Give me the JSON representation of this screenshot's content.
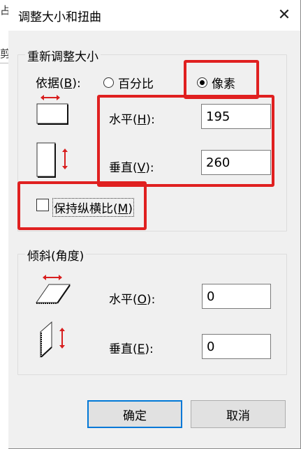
{
  "behind": {
    "glyph_top": "占",
    "glyph_mid": "剪"
  },
  "dialog": {
    "title": "调整大小和扭曲",
    "close_glyph": "✕"
  },
  "resize": {
    "legend": "重新调整大小",
    "basis_label_pre": "依据(",
    "basis_label_key": "B",
    "basis_label_post": "):",
    "options": [
      {
        "label": "百分比",
        "selected": false
      },
      {
        "label": "像素",
        "selected": true
      }
    ],
    "horizontal": {
      "label_pre": "水平(",
      "label_key": "H",
      "label_post": "):",
      "value": "195"
    },
    "vertical": {
      "label_pre": "垂直(",
      "label_key": "V",
      "label_post": "):",
      "value": "260"
    },
    "keep_ratio": {
      "label_pre": "保持纵横比(",
      "label_key": "M",
      "label_post": ")",
      "checked": false
    }
  },
  "skew": {
    "legend": "倾斜(角度)",
    "horizontal": {
      "label_pre": "水平(",
      "label_key": "O",
      "label_post": "):",
      "value": "0"
    },
    "vertical": {
      "label_pre": "垂直(",
      "label_key": "E",
      "label_post": "):",
      "value": "0"
    }
  },
  "buttons": {
    "ok": "确定",
    "cancel": "取消"
  },
  "colors": {
    "highlight": "#e02020",
    "accent": "#0078d7",
    "arrow": "#d81e1e"
  }
}
